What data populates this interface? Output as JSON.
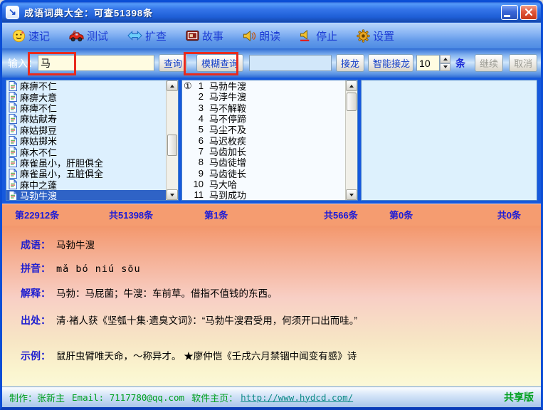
{
  "window": {
    "title": "成语词典大全：可查51398条"
  },
  "toolbar": {
    "items": [
      {
        "label": "速记",
        "icon": "smiley-icon"
      },
      {
        "label": "测试",
        "icon": "car-icon"
      },
      {
        "label": "扩查",
        "icon": "double-arrow-icon"
      },
      {
        "label": "故事",
        "icon": "story-icon"
      },
      {
        "label": "朗读",
        "icon": "speaker-icon"
      },
      {
        "label": "停止",
        "icon": "stop-speaker-icon"
      },
      {
        "label": "设置",
        "icon": "gear-icon"
      }
    ]
  },
  "query": {
    "input_label": "输入：",
    "search_value": "马",
    "query_button": "查询",
    "fuzzy_button": "模糊查询",
    "chain_value": "",
    "chain_button": "接龙",
    "smart_chain_button": "智能接龙",
    "count_value": "10",
    "count_unit": "条",
    "continue_button": "继续",
    "cancel_button": "取消"
  },
  "left_list": {
    "selected_index": 10,
    "items": [
      "麻痹不仁",
      "麻痹大意",
      "麻痺不仁",
      "麻姑献寿",
      "麻姑掷豆",
      "麻姑掷米",
      "麻木不仁",
      "麻雀虽小，肝胆俱全",
      "麻雀虽小，五脏俱全",
      "麻中之蓬",
      "马勃牛溲"
    ]
  },
  "result_list": {
    "items": [
      {
        "marker": "①",
        "num": "1",
        "text": "马勃牛溲"
      },
      {
        "marker": "",
        "num": "2",
        "text": "马浡牛溲"
      },
      {
        "marker": "",
        "num": "3",
        "text": "马不解鞍"
      },
      {
        "marker": "",
        "num": "4",
        "text": "马不停蹄"
      },
      {
        "marker": "",
        "num": "5",
        "text": "马尘不及"
      },
      {
        "marker": "",
        "num": "6",
        "text": "马迟枚疾"
      },
      {
        "marker": "",
        "num": "7",
        "text": "马齿加长"
      },
      {
        "marker": "",
        "num": "8",
        "text": "马齿徒增"
      },
      {
        "marker": "",
        "num": "9",
        "text": "马齿徒长"
      },
      {
        "marker": "",
        "num": "10",
        "text": "马大哈"
      },
      {
        "marker": "",
        "num": "11",
        "text": "马到成功"
      }
    ]
  },
  "stats": {
    "items": [
      "第22912条",
      "共51398条",
      "第1条",
      "共566条",
      "第0条",
      "共0条"
    ]
  },
  "detail": {
    "rows": [
      {
        "label": "成语：",
        "text": "马勃牛溲"
      },
      {
        "label": "拼音：",
        "text": "mǎ bó niú sōu"
      },
      {
        "label": "解释：",
        "text": "马勃：马屁菌；牛溲：车前草。借指不值钱的东西。"
      },
      {
        "label": "出处：",
        "text": "清·褚人获《坚瓠十集·遗臭文词》：“马勃牛溲君受用，何须开口出而哇。”"
      },
      {
        "label": "示例：",
        "text": "鼠肝虫臂唯天命，～称异才。 ★廖仲恺《壬戌六月禁锢中闻变有感》诗"
      }
    ]
  },
  "statusbar": {
    "maker": "制作：张新主",
    "email": "Email: 7117780@qq.com",
    "homepage_label": "软件主页：",
    "homepage_url": "http://www.hydcd.com/",
    "edition": "共享版"
  },
  "colors": {
    "titlebar_blue": "#2a62d8",
    "frame_blue": "#0b4ed6",
    "selection_blue": "#2f63c6",
    "stats_salmon": "#f59c70",
    "annotation_red": "#e82b1d",
    "status_green": "#00a01e",
    "link_teal": "#0b8a86",
    "toolbar_text_blue": "#1c3cd4"
  },
  "icons": {
    "app_glyph": "↘"
  }
}
